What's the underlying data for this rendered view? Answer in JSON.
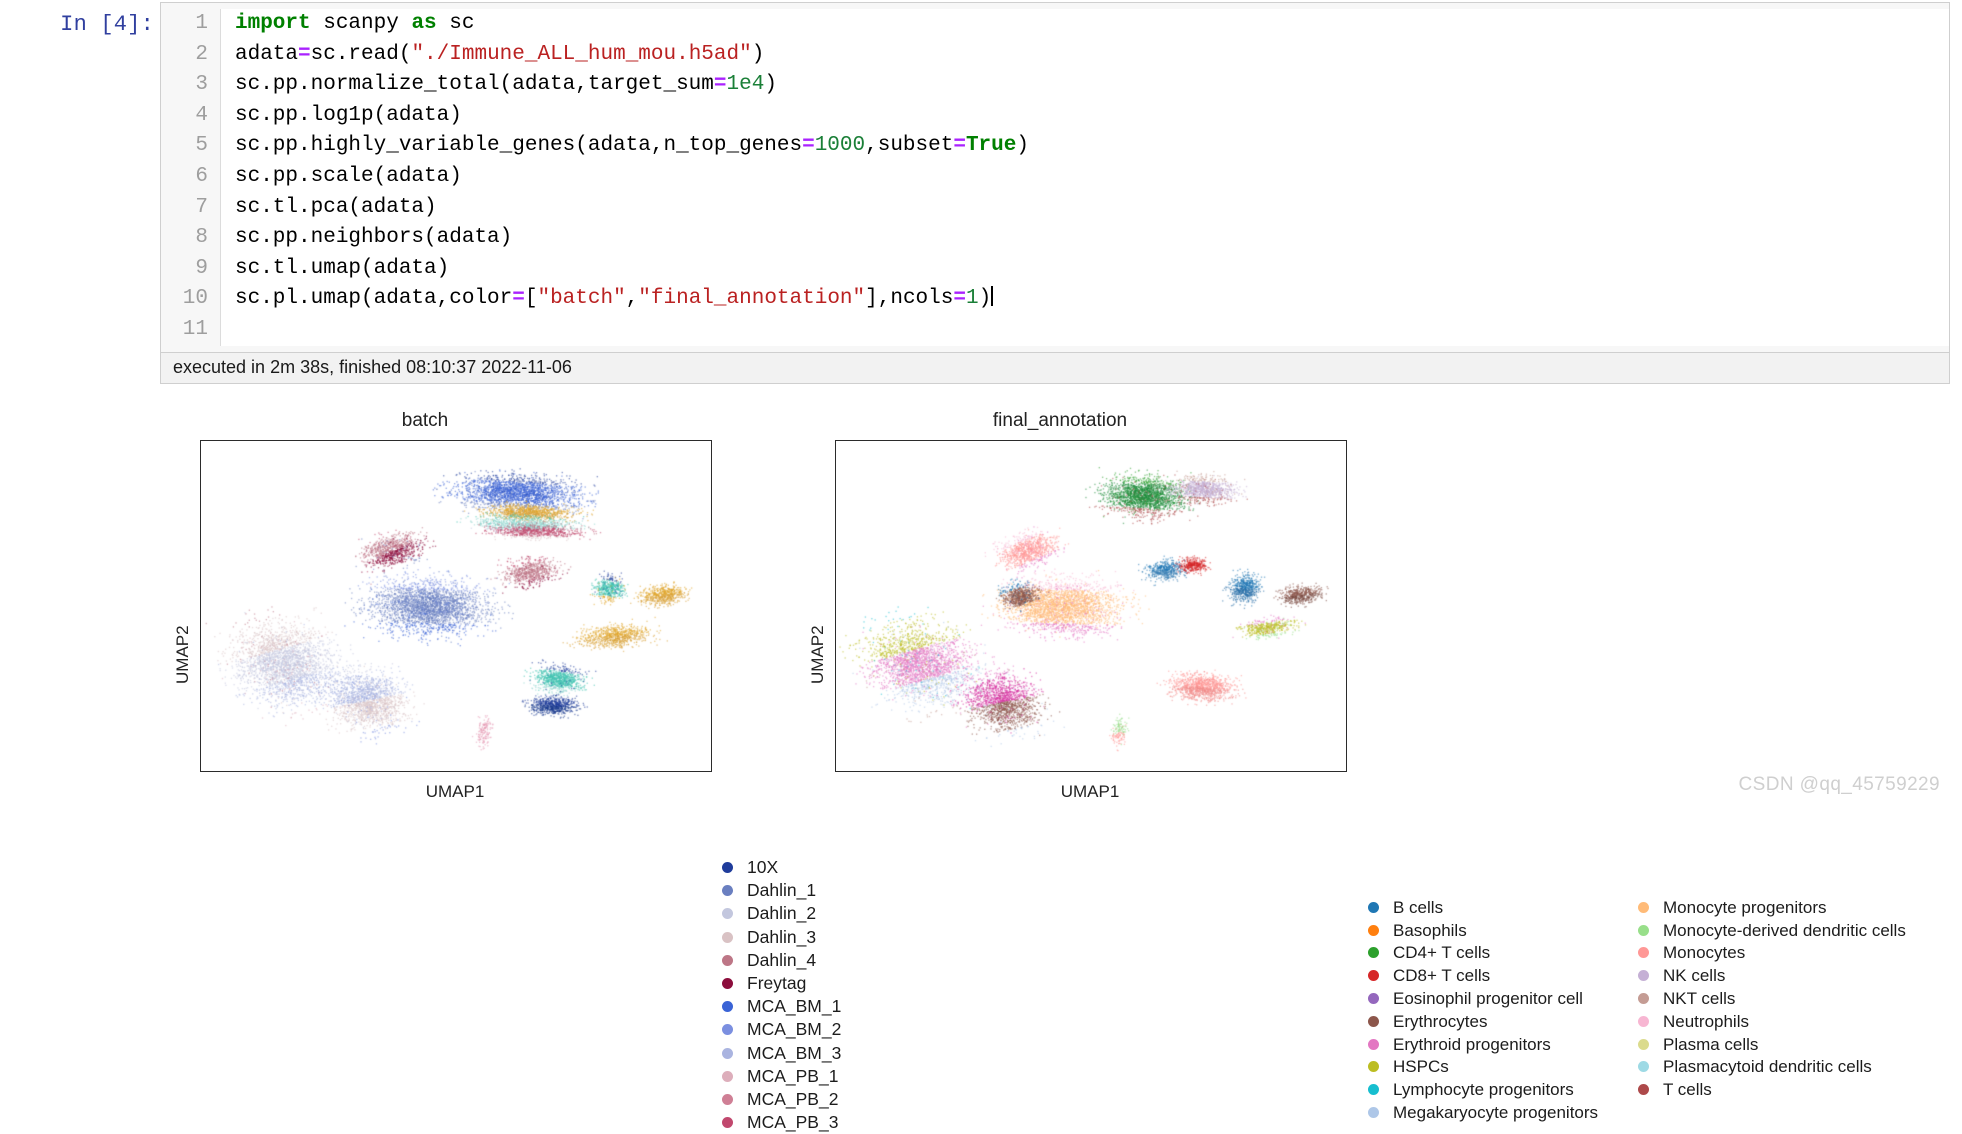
{
  "notebook": {
    "prompt_label": "In [4]:",
    "line_numbers": [
      "1",
      "2",
      "3",
      "4",
      "5",
      "6",
      "7",
      "8",
      "9",
      "10",
      "11"
    ],
    "code_lines": [
      "import scanpy as sc",
      "adata=sc.read(\"./Immune_ALL_hum_mou.h5ad\")",
      "sc.pp.normalize_total(adata,target_sum=1e4)",
      "sc.pp.log1p(adata)",
      "sc.pp.highly_variable_genes(adata,n_top_genes=1000,subset=True)",
      "sc.pp.scale(adata)",
      "sc.tl.pca(adata)",
      "sc.pp.neighbors(adata)",
      "sc.tl.umap(adata)",
      "sc.pl.umap(adata,color=[\"batch\",\"final_annotation\"],ncols=1)",
      ""
    ],
    "execution_status": "executed in 2m 38s, finished 08:10:37 2022-11-06"
  },
  "watermark": "CSDN @qq_45759229",
  "chart_data": [
    {
      "type": "scatter",
      "title": "batch",
      "xlabel": "UMAP1",
      "ylabel": "UMAP2",
      "grid": false,
      "legend_position": "right",
      "legend_truncated": true,
      "categories": [
        {
          "label": "10X",
          "color": "#1f3c9b"
        },
        {
          "label": "Dahlin_1",
          "color": "#6a7fc0"
        },
        {
          "label": "Dahlin_2",
          "color": "#c3c7de"
        },
        {
          "label": "Dahlin_3",
          "color": "#d9c2c4"
        },
        {
          "label": "Dahlin_4",
          "color": "#bd7686"
        },
        {
          "label": "Freytag",
          "color": "#8c0d3c"
        },
        {
          "label": "MCA_BM_1",
          "color": "#3a63d6"
        },
        {
          "label": "MCA_BM_2",
          "color": "#7b8fe0"
        },
        {
          "label": "MCA_BM_3",
          "color": "#aab4e0"
        },
        {
          "label": "MCA_PB_1",
          "color": "#ddaebb"
        },
        {
          "label": "MCA_PB_2",
          "color": "#cf7f95"
        },
        {
          "label": "MCA_PB_3",
          "color": "#c1486e"
        }
      ],
      "clusters": [
        {
          "cx": 0.165,
          "cy": 0.675,
          "rx": 0.115,
          "ry": 0.145,
          "n": 2600,
          "colors": [
            "#bd7686",
            "#d9c2c4",
            "#c3c7de",
            "#aab4e0",
            "#ddaebb"
          ],
          "rot": -0.4
        },
        {
          "cx": 0.325,
          "cy": 0.785,
          "rx": 0.085,
          "ry": 0.105,
          "n": 1700,
          "colors": [
            "#c3c7de",
            "#aab4e0",
            "#d9c2c4",
            "#7b8fe0"
          ],
          "rot": -0.3
        },
        {
          "cx": 0.445,
          "cy": 0.5,
          "rx": 0.135,
          "ry": 0.095,
          "n": 2800,
          "colors": [
            "#7b8fe0",
            "#6a7fc0",
            "#3a63d6"
          ],
          "rot": 0.05
        },
        {
          "cx": 0.375,
          "cy": 0.33,
          "rx": 0.075,
          "ry": 0.055,
          "n": 900,
          "colors": [
            "#c1486e",
            "#bd7686",
            "#8c0d3c",
            "#6a7fc0"
          ],
          "rot": -0.6
        },
        {
          "cx": 0.62,
          "cy": 0.155,
          "rx": 0.145,
          "ry": 0.062,
          "n": 2200,
          "colors": [
            "#1f3c9b",
            "#3a63d6",
            "#6a7fc0"
          ],
          "rot": 0.1
        },
        {
          "cx": 0.64,
          "cy": 0.215,
          "rx": 0.105,
          "ry": 0.028,
          "n": 900,
          "colors": [
            "#e0a52b",
            "#d9a33a"
          ],
          "rot": 0.05
        },
        {
          "cx": 0.635,
          "cy": 0.25,
          "rx": 0.12,
          "ry": 0.03,
          "n": 800,
          "colors": [
            "#3fc2b0",
            "#8fd6cd",
            "#c3c7de"
          ],
          "rot": 0.04
        },
        {
          "cx": 0.655,
          "cy": 0.272,
          "rx": 0.11,
          "ry": 0.026,
          "n": 700,
          "colors": [
            "#bd7686",
            "#c1486e",
            "#d9c2c4"
          ],
          "rot": 0.03
        },
        {
          "cx": 0.645,
          "cy": 0.395,
          "rx": 0.065,
          "ry": 0.045,
          "n": 700,
          "colors": [
            "#c1486e",
            "#bd7686",
            "#8c0d3c"
          ],
          "rot": -0.3
        },
        {
          "cx": 0.8,
          "cy": 0.445,
          "rx": 0.035,
          "ry": 0.045,
          "n": 500,
          "colors": [
            "#1f3c9b",
            "#3fc2b0",
            "#e0a52b"
          ],
          "rot": 0.2
        },
        {
          "cx": 0.905,
          "cy": 0.465,
          "rx": 0.055,
          "ry": 0.035,
          "n": 600,
          "colors": [
            "#e0a52b",
            "#d9a33a"
          ],
          "rot": -0.2
        },
        {
          "cx": 0.81,
          "cy": 0.59,
          "rx": 0.085,
          "ry": 0.04,
          "n": 800,
          "colors": [
            "#e0a52b",
            "#d9a33a"
          ],
          "rot": -0.15
        },
        {
          "cx": 0.7,
          "cy": 0.72,
          "rx": 0.06,
          "ry": 0.045,
          "n": 900,
          "colors": [
            "#1f3c9b",
            "#3fc2b0",
            "#8fd6cd"
          ],
          "rot": 0.25
        },
        {
          "cx": 0.69,
          "cy": 0.8,
          "rx": 0.055,
          "ry": 0.032,
          "n": 700,
          "colors": [
            "#1f3c9b",
            "#17388c"
          ],
          "rot": 0.1
        },
        {
          "cx": 0.555,
          "cy": 0.88,
          "rx": 0.018,
          "ry": 0.055,
          "n": 150,
          "colors": [
            "#e59bb5"
          ],
          "rot": 0.1
        }
      ]
    },
    {
      "type": "scatter",
      "title": "final_annotation",
      "xlabel": "UMAP1",
      "ylabel": "UMAP2",
      "grid": false,
      "legend_position": "right",
      "legend_columns": 2,
      "categories_col1": [
        {
          "label": "B cells",
          "color": "#1f77b4"
        },
        {
          "label": "Basophils",
          "color": "#ff7f0e"
        },
        {
          "label": "CD4+ T cells",
          "color": "#2ca02c"
        },
        {
          "label": "CD8+ T cells",
          "color": "#d62728"
        },
        {
          "label": "Eosinophil progenitor cell",
          "color": "#9467bd"
        },
        {
          "label": "Erythrocytes",
          "color": "#8c564b"
        },
        {
          "label": "Erythroid progenitors",
          "color": "#e377c2"
        },
        {
          "label": "HSPCs",
          "color": "#bcbd22"
        },
        {
          "label": "Lymphocyte progenitors",
          "color": "#17becf"
        },
        {
          "label": "Megakaryocyte progenitors",
          "color": "#aec7e8"
        }
      ],
      "categories_col2": [
        {
          "label": "Monocyte progenitors",
          "color": "#ffbb78"
        },
        {
          "label": "Monocyte-derived dendritic cells",
          "color": "#98df8a"
        },
        {
          "label": "Monocytes",
          "color": "#ff9896"
        },
        {
          "label": "NK cells",
          "color": "#c5b0d5"
        },
        {
          "label": "NKT cells",
          "color": "#c49c94"
        },
        {
          "label": "Neutrophils",
          "color": "#f7b6d2"
        },
        {
          "label": "Plasma cells",
          "color": "#dbdb8d"
        },
        {
          "label": "Plasmacytoid dendritic cells",
          "color": "#9edae5"
        },
        {
          "label": "T cells",
          "color": "#ad494a"
        }
      ],
      "clusters": [
        {
          "cx": 0.165,
          "cy": 0.675,
          "rx": 0.115,
          "ry": 0.145,
          "n": 2600,
          "colors": [
            "#17becf",
            "#bcbd22",
            "#e377c2",
            "#aec7e8",
            "#c49c94"
          ],
          "rot": -0.4
        },
        {
          "cx": 0.325,
          "cy": 0.79,
          "rx": 0.085,
          "ry": 0.105,
          "n": 1700,
          "colors": [
            "#e377c2",
            "#d62e9e",
            "#8c564b",
            "#aec7e8"
          ],
          "rot": -0.3
        },
        {
          "cx": 0.445,
          "cy": 0.5,
          "rx": 0.135,
          "ry": 0.095,
          "n": 2800,
          "colors": [
            "#f7b6d2",
            "#ffbb78",
            "#e377c2"
          ],
          "rot": 0.05
        },
        {
          "cx": 0.36,
          "cy": 0.47,
          "rx": 0.045,
          "ry": 0.045,
          "n": 700,
          "colors": [
            "#1f77b4",
            "#8c564b",
            "#ffbb78"
          ],
          "rot": -0.5
        },
        {
          "cx": 0.375,
          "cy": 0.33,
          "rx": 0.075,
          "ry": 0.055,
          "n": 900,
          "colors": [
            "#f7b6d2",
            "#ff9896",
            "#e377c2"
          ],
          "rot": -0.6
        },
        {
          "cx": 0.605,
          "cy": 0.165,
          "rx": 0.095,
          "ry": 0.07,
          "n": 2000,
          "colors": [
            "#2ca02c",
            "#1d8c3a",
            "#ad494a"
          ],
          "rot": 0.1
        },
        {
          "cx": 0.72,
          "cy": 0.145,
          "rx": 0.075,
          "ry": 0.045,
          "n": 1000,
          "colors": [
            "#c49c94",
            "#c5b0d5",
            "#ad494a"
          ],
          "rot": 0.05
        },
        {
          "cx": 0.645,
          "cy": 0.39,
          "rx": 0.045,
          "ry": 0.035,
          "n": 500,
          "colors": [
            "#1f77b4",
            "#3a7fb5"
          ],
          "rot": -0.1
        },
        {
          "cx": 0.7,
          "cy": 0.375,
          "rx": 0.035,
          "ry": 0.025,
          "n": 350,
          "colors": [
            "#d62728"
          ],
          "rot": 0.0
        },
        {
          "cx": 0.8,
          "cy": 0.445,
          "rx": 0.035,
          "ry": 0.048,
          "n": 600,
          "colors": [
            "#1f77b4",
            "#2a6fa8"
          ],
          "rot": 0.15
        },
        {
          "cx": 0.91,
          "cy": 0.465,
          "rx": 0.05,
          "ry": 0.03,
          "n": 500,
          "colors": [
            "#8c564b",
            "#7a4a41"
          ],
          "rot": -0.2
        },
        {
          "cx": 0.845,
          "cy": 0.565,
          "rx": 0.065,
          "ry": 0.032,
          "n": 500,
          "colors": [
            "#e377c2",
            "#bcbd22",
            "#98df8a"
          ],
          "rot": -0.2
        },
        {
          "cx": 0.715,
          "cy": 0.745,
          "rx": 0.075,
          "ry": 0.048,
          "n": 1100,
          "colors": [
            "#ff9896",
            "#f08a88"
          ],
          "rot": 0.1
        },
        {
          "cx": 0.555,
          "cy": 0.88,
          "rx": 0.018,
          "ry": 0.055,
          "n": 150,
          "colors": [
            "#98df8a",
            "#ff9896"
          ],
          "rot": 0.1
        }
      ]
    }
  ]
}
